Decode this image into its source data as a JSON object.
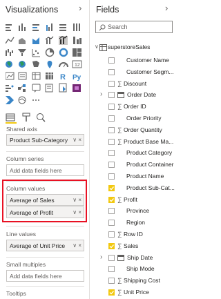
{
  "viz": {
    "title": "Visualizations",
    "collapse_icon": "chevron-right-icon"
  },
  "wells": {
    "shared_axis": {
      "label": "Shared axis",
      "value": "Product Sub-Category"
    },
    "column_series": {
      "label": "Column series",
      "value": "Add data fields here"
    },
    "column_values": {
      "label": "Column values",
      "values": [
        "Average of Sales",
        "Average of Profit"
      ]
    },
    "line_values": {
      "label": "Line values",
      "value": "Average of Unit Price"
    },
    "small_multiples": {
      "label": "Small multiples",
      "value": "Add data fields here"
    },
    "tooltips": {
      "label": "Tooltips"
    }
  },
  "fields": {
    "title": "Fields",
    "search_placeholder": "Search",
    "table": "superstoreSales",
    "items": [
      {
        "name": "Customer Name",
        "checked": false,
        "sigma": false,
        "expand": false
      },
      {
        "name": "Customer Segm...",
        "checked": false,
        "sigma": false,
        "expand": false
      },
      {
        "name": "Discount",
        "checked": false,
        "sigma": true,
        "expand": false
      },
      {
        "name": "Order Date",
        "checked": false,
        "sigma": false,
        "expand": true,
        "calendar": true
      },
      {
        "name": "Order ID",
        "checked": false,
        "sigma": true,
        "expand": false
      },
      {
        "name": "Order Priority",
        "checked": false,
        "sigma": false,
        "expand": false
      },
      {
        "name": "Order Quantity",
        "checked": false,
        "sigma": true,
        "expand": false
      },
      {
        "name": "Product Base Ma...",
        "checked": false,
        "sigma": true,
        "expand": false
      },
      {
        "name": "Product Category",
        "checked": false,
        "sigma": false,
        "expand": false
      },
      {
        "name": "Product Container",
        "checked": false,
        "sigma": false,
        "expand": false
      },
      {
        "name": "Product Name",
        "checked": false,
        "sigma": false,
        "expand": false
      },
      {
        "name": "Product Sub-Cat...",
        "checked": true,
        "sigma": false,
        "expand": false
      },
      {
        "name": "Profit",
        "checked": true,
        "sigma": true,
        "expand": false
      },
      {
        "name": "Province",
        "checked": false,
        "sigma": false,
        "expand": false
      },
      {
        "name": "Region",
        "checked": false,
        "sigma": false,
        "expand": false
      },
      {
        "name": "Row ID",
        "checked": false,
        "sigma": true,
        "expand": false
      },
      {
        "name": "Sales",
        "checked": true,
        "sigma": true,
        "expand": false
      },
      {
        "name": "Ship Date",
        "checked": false,
        "sigma": false,
        "expand": true,
        "calendar": true
      },
      {
        "name": "Ship Mode",
        "checked": false,
        "sigma": false,
        "expand": false
      },
      {
        "name": "Shipping Cost",
        "checked": false,
        "sigma": true,
        "expand": false
      },
      {
        "name": "Unit Price",
        "checked": true,
        "sigma": true,
        "expand": false
      }
    ]
  },
  "colors": {
    "highlight": "#e81123",
    "accent": "#f2c80f"
  }
}
